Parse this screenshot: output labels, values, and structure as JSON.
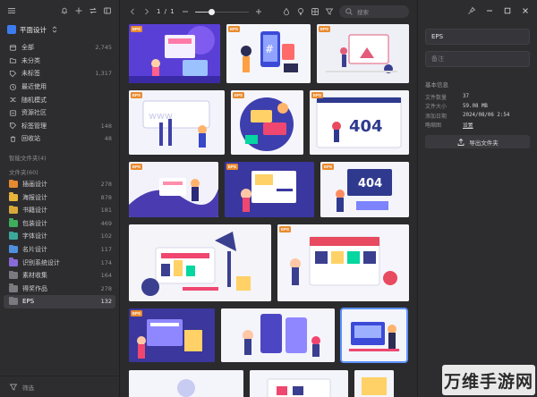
{
  "sidebar": {
    "library_name": "平面设计",
    "nav": [
      {
        "label": "全部",
        "count": "2,745",
        "icon": "all-icon"
      },
      {
        "label": "未分类",
        "count": "",
        "icon": "uncategorized-icon"
      },
      {
        "label": "未标签",
        "count": "1,317",
        "icon": "untagged-icon"
      },
      {
        "label": "最近使用",
        "count": "",
        "icon": "recent-icon"
      },
      {
        "label": "随机模式",
        "count": "",
        "icon": "random-icon"
      },
      {
        "label": "资源社区",
        "count": "",
        "icon": "community-icon"
      },
      {
        "label": "标签管理",
        "count": "148",
        "icon": "tag-icon"
      },
      {
        "label": "回收站",
        "count": "48",
        "icon": "trash-icon"
      }
    ],
    "smart_folders_label": "智能文件夹(4)",
    "folders_label": "文件夹(60)",
    "folders": [
      {
        "label": "插画设计",
        "count": "278",
        "color": "#e58a2f"
      },
      {
        "label": "海报设计",
        "count": "878",
        "color": "#e7b53a"
      },
      {
        "label": "书籍设计",
        "count": "181",
        "color": "#d8a83a"
      },
      {
        "label": "包装设计",
        "count": "469",
        "color": "#3fae5b"
      },
      {
        "label": "字体设计",
        "count": "102",
        "color": "#3ba89a"
      },
      {
        "label": "名片设计",
        "count": "117",
        "color": "#4f8fe0"
      },
      {
        "label": "识别系统设计",
        "count": "174",
        "color": "#8a6ad8"
      },
      {
        "label": "素材收集",
        "count": "164",
        "color": "#7a7a80"
      },
      {
        "label": "得奖作品",
        "count": "278",
        "color": "#7a7a80"
      },
      {
        "label": "EPS",
        "count": "132",
        "color": "#7a7a80"
      }
    ],
    "filter_label": "筛选"
  },
  "toolbar": {
    "pager": "1 / 1",
    "zoom_fraction": 0.32,
    "search_placeholder": "搜索"
  },
  "gallery": {
    "badge": "EPS",
    "selected_index": 13
  },
  "inspector": {
    "name_value": "EPS",
    "note_placeholder": "备注",
    "info_title": "基本信息",
    "info": [
      {
        "key": "文件数量",
        "value": "37",
        "link": false
      },
      {
        "key": "文件大小",
        "value": "59.08 MB",
        "link": false
      },
      {
        "key": "添加日期",
        "value": "2024/08/06 2:54",
        "link": false
      },
      {
        "key": "略缩图",
        "value": "设置",
        "link": true
      }
    ],
    "export_label": "导出文件夹"
  },
  "watermark": {
    "text": "万维手游网"
  },
  "colors": {
    "accent": "#5c93ff",
    "eps_badge": "#e98b2f",
    "panel": "#2d2d30",
    "bg": "#2b2b2e"
  }
}
